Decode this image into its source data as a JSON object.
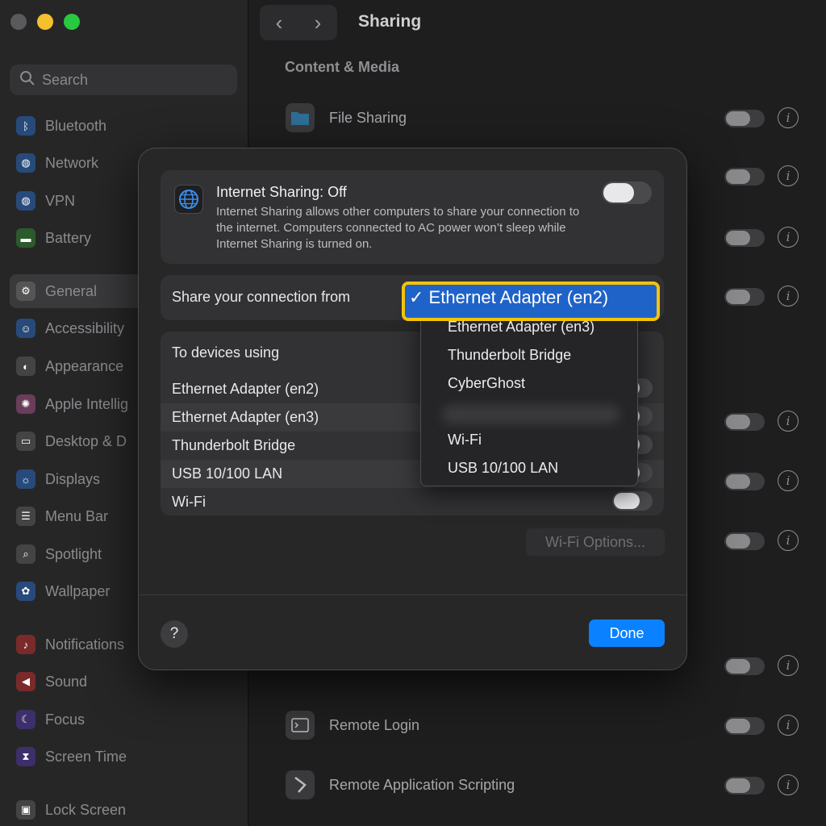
{
  "sidebar": {
    "search_placeholder": "Search",
    "items": [
      {
        "label": "Bluetooth",
        "icon": "bluetooth-icon"
      },
      {
        "label": "Network",
        "icon": "globe-icon"
      },
      {
        "label": "VPN",
        "icon": "vpn-globe-icon"
      },
      {
        "label": "Battery",
        "icon": "battery-icon"
      },
      {
        "label": "General",
        "icon": "gear-icon",
        "selected": true
      },
      {
        "label": "Accessibility",
        "icon": "accessibility-icon"
      },
      {
        "label": "Appearance",
        "icon": "appearance-icon"
      },
      {
        "label": "Apple Intellig",
        "icon": "apple-intelligence-icon"
      },
      {
        "label": "Desktop & D",
        "icon": "desktop-dock-icon"
      },
      {
        "label": "Displays",
        "icon": "sun-icon"
      },
      {
        "label": "Menu Bar",
        "icon": "menu-bar-icon"
      },
      {
        "label": "Spotlight",
        "icon": "magnifier-icon"
      },
      {
        "label": "Wallpaper",
        "icon": "flower-icon"
      },
      {
        "label": "Notifications",
        "icon": "bell-icon"
      },
      {
        "label": "Sound",
        "icon": "speaker-icon"
      },
      {
        "label": "Focus",
        "icon": "moon-icon"
      },
      {
        "label": "Screen Time",
        "icon": "hourglass-icon"
      },
      {
        "label": "Lock Screen",
        "icon": "lock-icon"
      }
    ]
  },
  "header": {
    "title": "Sharing",
    "back": "‹",
    "forward": "›"
  },
  "content": {
    "section": "Content & Media",
    "rows": [
      {
        "label": "File Sharing",
        "icon": "folder-icon"
      },
      {
        "label": "Remote Login",
        "icon": "terminal-icon"
      },
      {
        "label": "Remote Application Scripting",
        "icon": "script-icon"
      }
    ]
  },
  "sheet": {
    "sharing_title": "Internet Sharing: Off",
    "sharing_desc": "Internet Sharing allows other computers to share your connection to the internet. Computers connected to AC power won’t sleep while Internet Sharing is turned on.",
    "from_label": "Share your connection from",
    "devices_label": "To devices using",
    "devices": [
      "Ethernet Adapter (en2)",
      "Ethernet Adapter (en3)",
      "Thunderbolt Bridge",
      "USB 10/100 LAN",
      "Wi-Fi"
    ],
    "wifi_options": "Wi-Fi Options...",
    "help": "?",
    "done": "Done"
  },
  "menu": {
    "selected": "✓ Ethernet Adapter (en2)",
    "items": [
      "Ethernet Adapter (en3)",
      "Thunderbolt Bridge",
      "CyberGhost",
      "Wi-Fi",
      "USB 10/100 LAN"
    ]
  },
  "colors": {
    "accent": "#0a82ff",
    "highlight_border": "#f4c20a",
    "selection": "#1f63c8"
  }
}
